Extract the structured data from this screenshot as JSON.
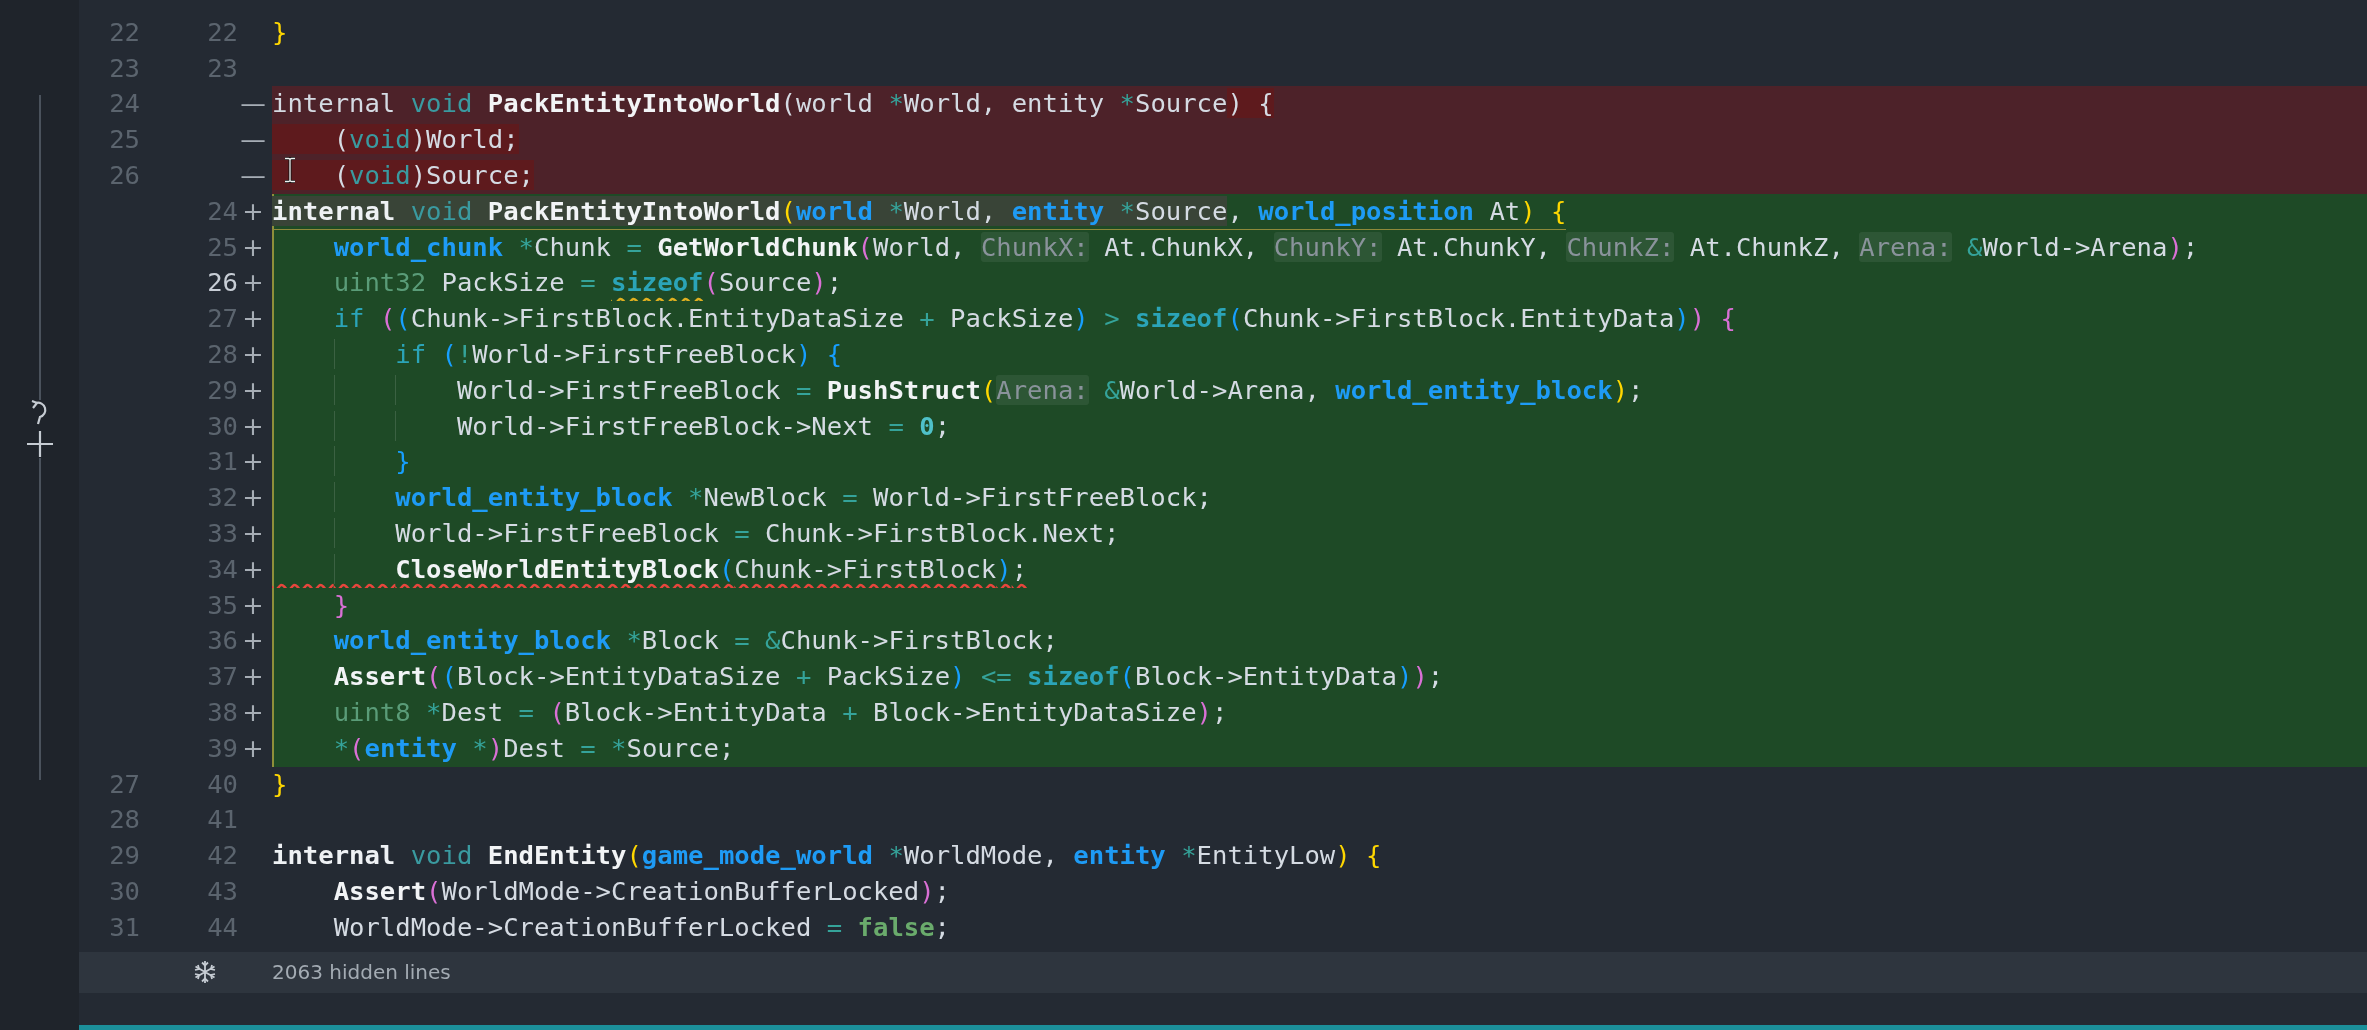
{
  "editor": {
    "lines": [
      {
        "old": "22",
        "new": "22",
        "kind": "context",
        "current": false,
        "tokens": [
          {
            "text": "}",
            "kind": "bracket",
            "color": "#ffd700"
          }
        ]
      },
      {
        "old": "23",
        "new": "23",
        "kind": "context",
        "current": false
      },
      {
        "old": "24",
        "sign": "—",
        "kind": "removed",
        "current": false,
        "tokens": [
          {
            "text": "internal ",
            "kind": "plain",
            "changed": false
          },
          {
            "text": "void",
            "kind": "void",
            "changed": false
          },
          {
            "text": " PackEntityIntoWorld",
            "kind": "function",
            "changed": false
          },
          {
            "text": "(world ",
            "kind": "plain",
            "changed": false
          },
          {
            "text": "*",
            "kind": "operator",
            "changed": false
          },
          {
            "text": "World, entity ",
            "kind": "plain",
            "changed": false
          },
          {
            "text": "*",
            "kind": "operator",
            "changed": false
          },
          {
            "text": "Source",
            "kind": "plain",
            "changed": false
          },
          {
            "text": ") {",
            "kind": "plain",
            "changed": true
          }
        ]
      },
      {
        "old": "25",
        "sign": "—",
        "kind": "removed",
        "current": false,
        "tokens": [
          {
            "text": "    (",
            "kind": "plain",
            "changed": true
          },
          {
            "text": "void",
            "kind": "void",
            "changed": true
          },
          {
            "text": ")World;",
            "kind": "plain",
            "changed": true
          }
        ]
      },
      {
        "old": "26",
        "sign": "—",
        "kind": "removed",
        "current": false,
        "tokens": [
          {
            "text": "    (",
            "kind": "plain",
            "changed": true
          },
          {
            "text": "void",
            "kind": "void",
            "changed": true
          },
          {
            "text": ")Source;",
            "kind": "plain",
            "changed": true
          }
        ]
      },
      {
        "new": "24",
        "sign": "+",
        "kind": "added",
        "current": false,
        "underlined": true,
        "tokens": [
          {
            "text": "internal",
            "kind": "storage",
            "changed": true
          },
          {
            "text": " void",
            "kind": "void",
            "changed": true
          },
          {
            "text": " PackEntityIntoWorld",
            "kind": "function",
            "changed": true
          },
          {
            "text": "(",
            "kind": "bracket",
            "color": "#ffd700",
            "changed": true
          },
          {
            "text": "world",
            "kind": "type",
            "changed": true
          },
          {
            "text": " *",
            "kind": "operator",
            "changed": true
          },
          {
            "text": "World, ",
            "kind": "plain",
            "changed": true
          },
          {
            "text": "entity",
            "kind": "type",
            "changed": true
          },
          {
            "text": " *",
            "kind": "operator",
            "changed": true
          },
          {
            "text": "Source",
            "kind": "plain",
            "changed": true
          },
          {
            "text": ", ",
            "kind": "plain",
            "changed": false
          },
          {
            "text": "world_position",
            "kind": "type",
            "changed": false
          },
          {
            "text": " At",
            "kind": "plain",
            "changed": false
          },
          {
            "text": ")",
            "kind": "bracket",
            "color": "#ffd700",
            "changed": false
          },
          {
            "text": " {",
            "kind": "bracket",
            "color": "#ffd700",
            "changed": false
          }
        ]
      },
      {
        "new": "25",
        "sign": "+",
        "kind": "added",
        "current": false,
        "tokens": [
          {
            "text": "    world_chunk",
            "kind": "type"
          },
          {
            "text": " *",
            "kind": "operator"
          },
          {
            "text": "Chunk ",
            "kind": "plain"
          },
          {
            "text": "=",
            "kind": "operator"
          },
          {
            "text": " GetWorldChunk",
            "kind": "function"
          },
          {
            "text": "(",
            "kind": "bracket",
            "color": "#da70d6"
          },
          {
            "text": "World, ",
            "kind": "plain"
          },
          {
            "text": "ChunkX:",
            "kind": "hint"
          },
          {
            "text": " At.ChunkX, ",
            "kind": "plain"
          },
          {
            "text": "ChunkY:",
            "kind": "hint"
          },
          {
            "text": " At.ChunkY, ",
            "kind": "plain"
          },
          {
            "text": "ChunkZ:",
            "kind": "hint"
          },
          {
            "text": " At.ChunkZ, ",
            "kind": "plain"
          },
          {
            "text": "Arena:",
            "kind": "hint"
          },
          {
            "text": " &",
            "kind": "operator"
          },
          {
            "text": "World->Arena",
            "kind": "plain"
          },
          {
            "text": ")",
            "kind": "bracket",
            "color": "#da70d6"
          },
          {
            "text": ";",
            "kind": "plain"
          }
        ]
      },
      {
        "new": "26",
        "sign": "+",
        "kind": "added",
        "current": true,
        "tokens": [
          {
            "text": "    uint32",
            "kind": "primitive"
          },
          {
            "text": " PackSize ",
            "kind": "plain"
          },
          {
            "text": "= ",
            "kind": "operator"
          },
          {
            "text": "sizeof",
            "kind": "keyword",
            "warning": true
          },
          {
            "text": "(",
            "kind": "bracket",
            "color": "#da70d6"
          },
          {
            "text": "Source",
            "kind": "plain"
          },
          {
            "text": ")",
            "kind": "bracket",
            "color": "#da70d6"
          },
          {
            "text": ";",
            "kind": "plain"
          }
        ]
      },
      {
        "new": "27",
        "sign": "+",
        "kind": "added",
        "current": false,
        "tokens": [
          {
            "text": "    if",
            "kind": "control"
          },
          {
            "text": " (",
            "kind": "bracket",
            "color": "#da70d6"
          },
          {
            "text": "(",
            "kind": "bracket",
            "color": "#179fff"
          },
          {
            "text": "Chunk->FirstBlock.EntityDataSize ",
            "kind": "plain"
          },
          {
            "text": "+",
            "kind": "operator"
          },
          {
            "text": " PackSize",
            "kind": "plain"
          },
          {
            "text": ")",
            "kind": "bracket",
            "color": "#179fff"
          },
          {
            "text": " >",
            "kind": "operator"
          },
          {
            "text": " sizeof",
            "kind": "keyword"
          },
          {
            "text": "(",
            "kind": "bracket",
            "color": "#179fff"
          },
          {
            "text": "Chunk->FirstBlock.EntityData",
            "kind": "plain"
          },
          {
            "text": ")",
            "kind": "bracket",
            "color": "#179fff"
          },
          {
            "text": ")",
            "kind": "bracket",
            "color": "#da70d6"
          },
          {
            "text": " {",
            "kind": "bracket",
            "color": "#da70d6"
          }
        ]
      },
      {
        "new": "28",
        "sign": "+",
        "kind": "added",
        "current": false,
        "tokens": [
          {
            "text": "        if",
            "kind": "control"
          },
          {
            "text": " (",
            "kind": "bracket",
            "color": "#179fff"
          },
          {
            "text": "!",
            "kind": "operator"
          },
          {
            "text": "World->FirstFreeBlock",
            "kind": "plain"
          },
          {
            "text": ")",
            "kind": "bracket",
            "color": "#179fff"
          },
          {
            "text": " {",
            "kind": "bracket",
            "color": "#179fff"
          }
        ]
      },
      {
        "new": "29",
        "sign": "+",
        "kind": "added",
        "current": false,
        "tokens": [
          {
            "text": "            World->FirstFreeBlock ",
            "kind": "plain"
          },
          {
            "text": "=",
            "kind": "operator"
          },
          {
            "text": " PushStruct",
            "kind": "function"
          },
          {
            "text": "(",
            "kind": "bracket",
            "color": "#ffd700"
          },
          {
            "text": "Arena:",
            "kind": "hint"
          },
          {
            "text": " &",
            "kind": "operator"
          },
          {
            "text": "World->Arena, ",
            "kind": "plain"
          },
          {
            "text": "world_entity_block",
            "kind": "type"
          },
          {
            "text": ")",
            "kind": "bracket",
            "color": "#ffd700"
          },
          {
            "text": ";",
            "kind": "plain"
          }
        ]
      },
      {
        "new": "30",
        "sign": "+",
        "kind": "added",
        "current": false,
        "tokens": [
          {
            "text": "            World->FirstFreeBlock->Next ",
            "kind": "plain"
          },
          {
            "text": "=",
            "kind": "operator"
          },
          {
            "text": " 0",
            "kind": "number"
          },
          {
            "text": ";",
            "kind": "plain"
          }
        ]
      },
      {
        "new": "31",
        "sign": "+",
        "kind": "added",
        "current": false,
        "tokens": [
          {
            "text": "        }",
            "kind": "bracket",
            "color": "#179fff"
          }
        ]
      },
      {
        "new": "32",
        "sign": "+",
        "kind": "added",
        "current": false,
        "tokens": [
          {
            "text": "        world_entity_block",
            "kind": "type"
          },
          {
            "text": " *",
            "kind": "operator"
          },
          {
            "text": "NewBlock ",
            "kind": "plain"
          },
          {
            "text": "=",
            "kind": "operator"
          },
          {
            "text": " World->FirstFreeBlock;",
            "kind": "plain"
          }
        ]
      },
      {
        "new": "33",
        "sign": "+",
        "kind": "added",
        "current": false,
        "tokens": [
          {
            "text": "        World->FirstFreeBlock ",
            "kind": "plain"
          },
          {
            "text": "=",
            "kind": "operator"
          },
          {
            "text": " Chunk->FirstBlock.Next;",
            "kind": "plain"
          }
        ]
      },
      {
        "new": "34",
        "sign": "+",
        "kind": "added",
        "current": false,
        "error": true,
        "tokens": [
          {
            "text": "        CloseWorldEntityBlock",
            "kind": "function"
          },
          {
            "text": "(",
            "kind": "bracket",
            "color": "#179fff"
          },
          {
            "text": "Chunk->FirstBlock",
            "kind": "plain"
          },
          {
            "text": ")",
            "kind": "bracket",
            "color": "#179fff"
          },
          {
            "text": ";",
            "kind": "plain"
          }
        ]
      },
      {
        "new": "35",
        "sign": "+",
        "kind": "added",
        "current": false,
        "tokens": [
          {
            "text": "    }",
            "kind": "bracket",
            "color": "#da70d6"
          }
        ]
      },
      {
        "new": "36",
        "sign": "+",
        "kind": "added",
        "current": false,
        "tokens": [
          {
            "text": "    world_entity_block",
            "kind": "type"
          },
          {
            "text": " *",
            "kind": "operator"
          },
          {
            "text": "Block ",
            "kind": "plain"
          },
          {
            "text": "=",
            "kind": "operator"
          },
          {
            "text": " &",
            "kind": "operator"
          },
          {
            "text": "Chunk->FirstBlock;",
            "kind": "plain"
          }
        ]
      },
      {
        "new": "37",
        "sign": "+",
        "kind": "added",
        "current": false,
        "tokens": [
          {
            "text": "    Assert",
            "kind": "function"
          },
          {
            "text": "(",
            "kind": "bracket",
            "color": "#da70d6"
          },
          {
            "text": "(",
            "kind": "bracket",
            "color": "#179fff"
          },
          {
            "text": "Block->EntityDataSize ",
            "kind": "plain"
          },
          {
            "text": "+",
            "kind": "operator"
          },
          {
            "text": " PackSize",
            "kind": "plain"
          },
          {
            "text": ")",
            "kind": "bracket",
            "color": "#179fff"
          },
          {
            "text": " <=",
            "kind": "operator"
          },
          {
            "text": " sizeof",
            "kind": "keyword"
          },
          {
            "text": "(",
            "kind": "bracket",
            "color": "#179fff"
          },
          {
            "text": "Block->EntityData",
            "kind": "plain"
          },
          {
            "text": ")",
            "kind": "bracket",
            "color": "#179fff"
          },
          {
            "text": ")",
            "kind": "bracket",
            "color": "#da70d6"
          },
          {
            "text": ";",
            "kind": "plain"
          }
        ]
      },
      {
        "new": "38",
        "sign": "+",
        "kind": "added",
        "current": false,
        "tokens": [
          {
            "text": "    uint8",
            "kind": "primitive"
          },
          {
            "text": " *",
            "kind": "operator"
          },
          {
            "text": "Dest ",
            "kind": "plain"
          },
          {
            "text": "=",
            "kind": "operator"
          },
          {
            "text": " (",
            "kind": "bracket",
            "color": "#da70d6"
          },
          {
            "text": "Block->EntityData ",
            "kind": "plain"
          },
          {
            "text": "+",
            "kind": "operator"
          },
          {
            "text": " Block->EntityDataSize",
            "kind": "plain"
          },
          {
            "text": ")",
            "kind": "bracket",
            "color": "#da70d6"
          },
          {
            "text": ";",
            "kind": "plain"
          }
        ]
      },
      {
        "new": "39",
        "sign": "+",
        "kind": "added",
        "current": false,
        "tokens": [
          {
            "text": "    *",
            "kind": "operator"
          },
          {
            "text": "(",
            "kind": "bracket",
            "color": "#da70d6"
          },
          {
            "text": "entity",
            "kind": "type"
          },
          {
            "text": " *",
            "kind": "operator"
          },
          {
            "text": ")",
            "kind": "bracket",
            "color": "#da70d6"
          },
          {
            "text": "Dest ",
            "kind": "plain"
          },
          {
            "text": "=",
            "kind": "operator"
          },
          {
            "text": " *",
            "kind": "operator"
          },
          {
            "text": "Source;",
            "kind": "plain"
          }
        ]
      },
      {
        "old": "27",
        "new": "40",
        "kind": "context",
        "current": false,
        "tokens": [
          {
            "text": "}",
            "kind": "bracket",
            "color": "#ffd700"
          }
        ]
      },
      {
        "old": "28",
        "new": "41",
        "kind": "context",
        "current": false
      },
      {
        "old": "29",
        "new": "42",
        "kind": "context",
        "current": false,
        "tokens": [
          {
            "text": "internal",
            "kind": "storage"
          },
          {
            "text": " void",
            "kind": "void"
          },
          {
            "text": " EndEntity",
            "kind": "function"
          },
          {
            "text": "(",
            "kind": "bracket",
            "color": "#ffd700"
          },
          {
            "text": "game_mode_world",
            "kind": "type"
          },
          {
            "text": " *",
            "kind": "operator"
          },
          {
            "text": "WorldMode, ",
            "kind": "plain"
          },
          {
            "text": "entity",
            "kind": "type"
          },
          {
            "text": " *",
            "kind": "operator"
          },
          {
            "text": "EntityLow",
            "kind": "plain"
          },
          {
            "text": ")",
            "kind": "bracket",
            "color": "#ffd700"
          },
          {
            "text": " {",
            "kind": "bracket",
            "color": "#ffd700"
          }
        ]
      },
      {
        "old": "30",
        "new": "43",
        "kind": "context",
        "current": false,
        "tokens": [
          {
            "text": "    Assert",
            "kind": "function"
          },
          {
            "text": "(",
            "kind": "bracket",
            "color": "#da70d6"
          },
          {
            "text": "WorldMode->CreationBufferLocked",
            "kind": "plain"
          },
          {
            "text": ")",
            "kind": "bracket",
            "color": "#da70d6"
          },
          {
            "text": ";",
            "kind": "plain"
          }
        ]
      },
      {
        "old": "31",
        "new": "44",
        "kind": "context",
        "current": false,
        "tokens": [
          {
            "text": "    WorldMode->CreationBufferLocked ",
            "kind": "plain"
          },
          {
            "text": "=",
            "kind": "operator"
          },
          {
            "text": " false",
            "kind": "boolean"
          },
          {
            "text": ";",
            "kind": "plain"
          }
        ]
      }
    ],
    "folded": {
      "label": "2063 hidden lines"
    }
  }
}
